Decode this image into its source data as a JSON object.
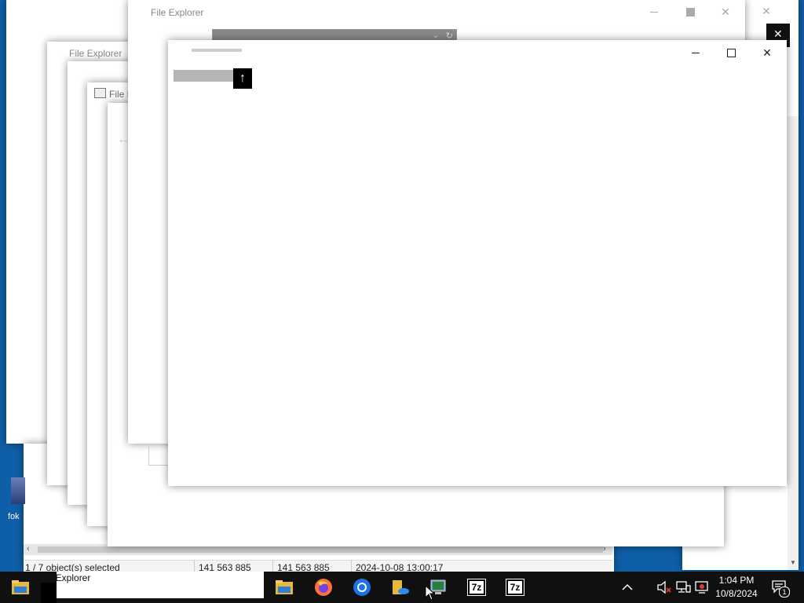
{
  "windows": {
    "top_title": "File Explorer",
    "left_title": "File Explorer",
    "mid_title": "File E",
    "back_arrow": "←"
  },
  "status_bar": {
    "selection": "1 / 7 object(s) selected",
    "size_1": "141 563 885",
    "size_2": "141 563 885",
    "modified": "2024-10-08 13:00:17"
  },
  "desktop": {
    "icon_label": "fok"
  },
  "taskbar": {
    "tooltip": "File Explorer",
    "time": "1:04 PM",
    "date": "10/8/2024",
    "notification_count": "1",
    "seven_zip_label": "7z",
    "tray_chevron": "^"
  },
  "front_window": {
    "up_arrow": "↑"
  },
  "colors": {
    "desktop": "#0f5fa8",
    "taskbar": "#101010",
    "accent": "#1e90ff"
  }
}
